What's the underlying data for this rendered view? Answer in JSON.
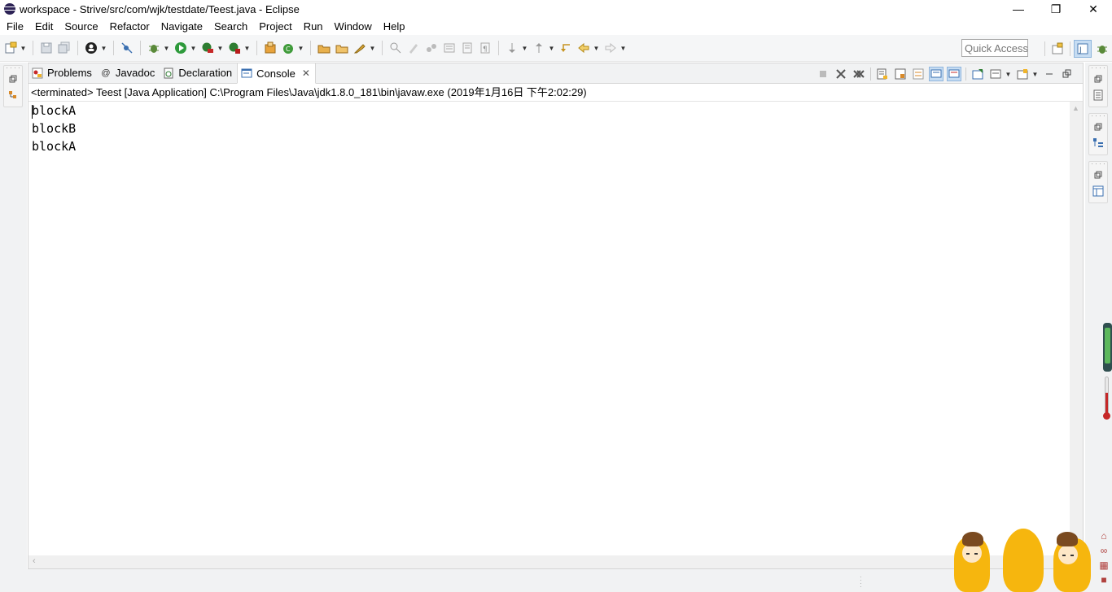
{
  "window": {
    "title": "workspace - Strive/src/com/wjk/testdate/Teest.java - Eclipse",
    "controls": {
      "minimize": "—",
      "maximize": "❐",
      "close": "✕"
    }
  },
  "menu": [
    "File",
    "Edit",
    "Source",
    "Refactor",
    "Navigate",
    "Search",
    "Project",
    "Run",
    "Window",
    "Help"
  ],
  "toolbar": {
    "quick_access_placeholder": "Quick Access",
    "icons": [
      "new-icon",
      "save-icon",
      "save-all-icon",
      "profile-icon",
      "skip-breakpoints-icon",
      "debug-icon",
      "run-icon",
      "coverage-icon",
      "external-tools-icon",
      "new-java-project-icon",
      "new-class-icon",
      "open-type-icon",
      "open-task-icon",
      "search-icon",
      "annotation-icon",
      "last-edit-icon",
      "back-icon",
      "forward-icon"
    ],
    "perspectives": [
      "open-perspective-icon",
      "java-perspective-icon",
      "debug-perspective-icon"
    ]
  },
  "view": {
    "tabs": [
      {
        "label": "Problems",
        "icon": "problems-icon"
      },
      {
        "label": "Javadoc",
        "icon": "javadoc-icon",
        "glyph": "@"
      },
      {
        "label": "Declaration",
        "icon": "declaration-icon"
      },
      {
        "label": "Console",
        "icon": "console-icon",
        "active": true,
        "close": "✕"
      }
    ],
    "console_header": "<terminated> Teest [Java Application] C:\\Program Files\\Java\\jdk1.8.0_181\\bin\\javaw.exe (2019年1月16日 下午2:02:29)",
    "console_lines": [
      "blockA",
      "blockB",
      "blockA"
    ]
  },
  "colors": {
    "accent": "#c6dcf2",
    "trim": "#f1f2f3",
    "mascot": "#f6b60e"
  }
}
